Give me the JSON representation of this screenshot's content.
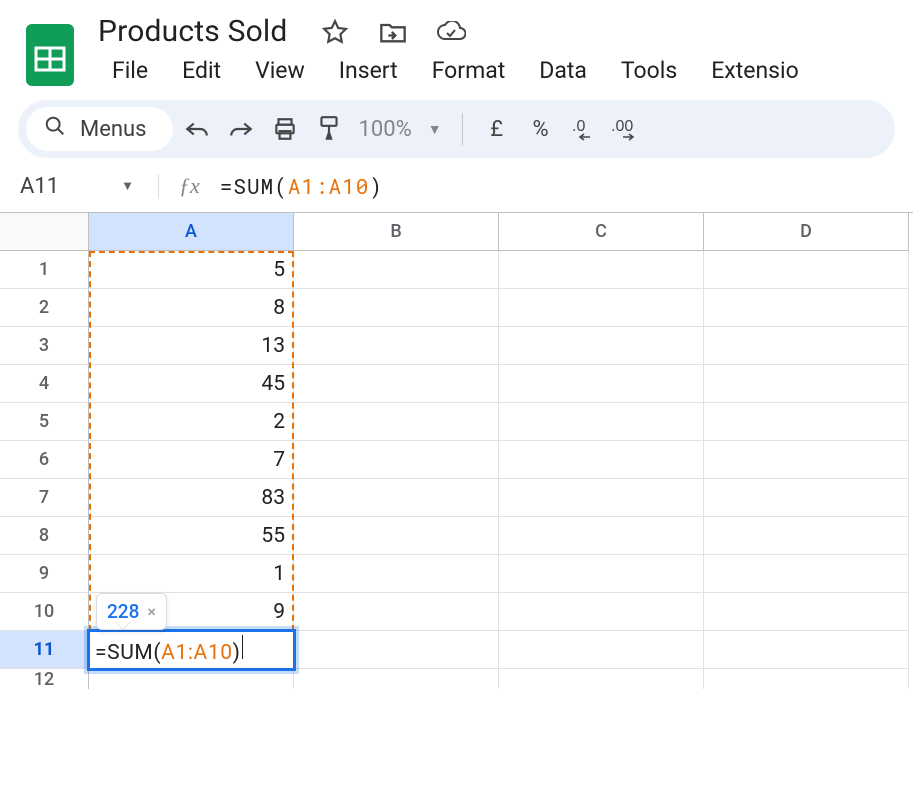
{
  "doc": {
    "title": "Products Sold"
  },
  "menus": {
    "pill_label": "Menus"
  },
  "menu_bar": {
    "file": "File",
    "edit": "Edit",
    "view": "View",
    "insert": "Insert",
    "format": "Format",
    "data": "Data",
    "tools": "Tools",
    "extensions": "Extensio"
  },
  "toolbar": {
    "zoom": "100%",
    "currency": "£",
    "percent": "%",
    "dec_dec": ".0",
    "inc_dec": ".00"
  },
  "namebox": {
    "ref": "A11"
  },
  "formula_bar": {
    "prefix": "=SUM(",
    "range": "A1:A10",
    "suffix": ")"
  },
  "columns": [
    "A",
    "B",
    "C",
    "D"
  ],
  "row_labels": [
    "1",
    "2",
    "3",
    "4",
    "5",
    "6",
    "7",
    "8",
    "9",
    "10",
    "11",
    "12"
  ],
  "cells": {
    "A": [
      "5",
      "8",
      "13",
      "45",
      "2",
      "7",
      "83",
      "55",
      "1",
      "9"
    ]
  },
  "active_cell": {
    "prefix": "=SUM(",
    "range": "A1:A10",
    "suffix": ")"
  },
  "tooltip": {
    "result": "228"
  },
  "chart_data": {
    "type": "table",
    "columns": [
      "A"
    ],
    "rows": [
      {
        "row": 1,
        "A": 5
      },
      {
        "row": 2,
        "A": 8
      },
      {
        "row": 3,
        "A": 13
      },
      {
        "row": 4,
        "A": 45
      },
      {
        "row": 5,
        "A": 2
      },
      {
        "row": 6,
        "A": 7
      },
      {
        "row": 7,
        "A": 83
      },
      {
        "row": 8,
        "A": 55
      },
      {
        "row": 9,
        "A": 1
      },
      {
        "row": 10,
        "A": 9
      }
    ],
    "formula": {
      "cell": "A11",
      "text": "=SUM(A1:A10)",
      "result": 228
    }
  }
}
